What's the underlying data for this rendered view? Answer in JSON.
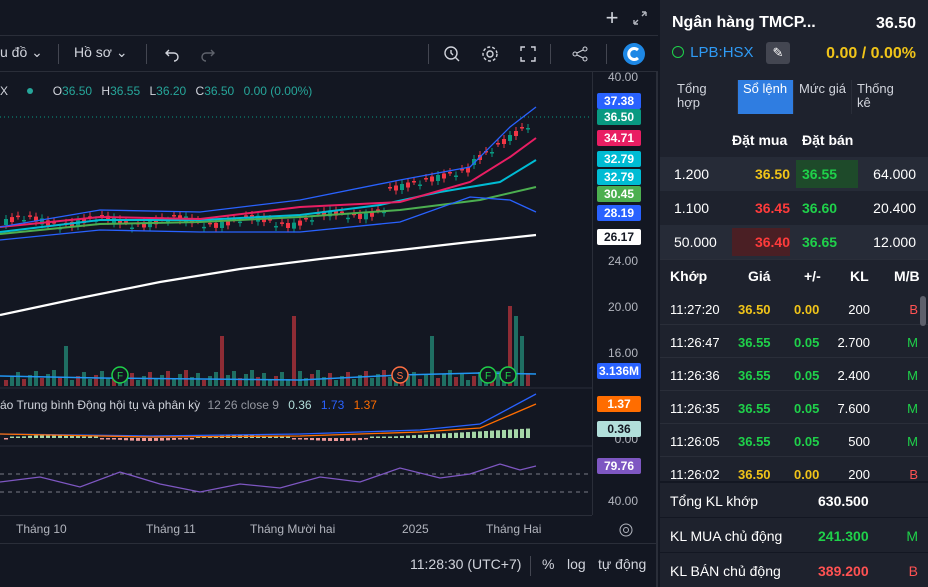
{
  "panel": {
    "company_name": "Ngân hàng TMCP...",
    "price": "36.50",
    "ticker": "LPB:HSX",
    "change": "0.00 / 0.00%",
    "tabs": [
      {
        "label": "Tổng hợp"
      },
      {
        "label": "Sổ lệnh"
      },
      {
        "label": "Mức giá"
      },
      {
        "label": "Thống kê"
      }
    ],
    "orderbook_headers": {
      "buy": "Đặt mua",
      "sell": "Đặt bán"
    },
    "orderbook": [
      {
        "buy_vol": "1.200",
        "buy_price": "36.50",
        "sell_price": "36.55",
        "sell_vol": "64.000"
      },
      {
        "buy_vol": "1.100",
        "buy_price": "36.45",
        "sell_price": "36.60",
        "sell_vol": "20.400"
      },
      {
        "buy_vol": "50.000",
        "buy_price": "36.40",
        "sell_price": "36.65",
        "sell_vol": "12.000"
      }
    ],
    "trade_headers": {
      "time": "Khớp",
      "price": "Giá",
      "change": "+/-",
      "vol": "KL",
      "side": "M/B"
    },
    "trades": [
      {
        "time": "11:27:20",
        "price": "36.50",
        "change": "0.00",
        "vol": "200",
        "side": "B"
      },
      {
        "time": "11:26:47",
        "price": "36.55",
        "change": "0.05",
        "vol": "2.700",
        "side": "M"
      },
      {
        "time": "11:26:36",
        "price": "36.55",
        "change": "0.05",
        "vol": "2.400",
        "side": "M"
      },
      {
        "time": "11:26:35",
        "price": "36.55",
        "change": "0.05",
        "vol": "7.600",
        "side": "M"
      },
      {
        "time": "11:26:05",
        "price": "36.55",
        "change": "0.05",
        "vol": "500",
        "side": "M"
      },
      {
        "time": "11:26:02",
        "price": "36.50",
        "change": "0.00",
        "vol": "200",
        "side": "B"
      }
    ],
    "summary": [
      {
        "label": "Tổng KL khớp",
        "value": "630.500",
        "side": ""
      },
      {
        "label": "KL MUA chủ động",
        "value": "241.300",
        "side": "M"
      },
      {
        "label": "KL BÁN chủ động",
        "value": "389.200",
        "side": "B"
      }
    ]
  },
  "toolbar": {
    "chart_type_label": "u đồ",
    "profile_label": "Hồ sơ"
  },
  "legend": {
    "symbol_tail": "X",
    "o_label": "O",
    "o_value": "36.50",
    "h_label": "H",
    "h_value": "36.55",
    "l_label": "L",
    "l_value": "36.20",
    "c_label": "C",
    "c_value": "36.50",
    "change": "0.00 (0.00%)"
  },
  "macd_legend": {
    "name": "áo Trung bình Động hội tụ và phân kỳ",
    "params": "12 26 close 9",
    "v1": "0.36",
    "v2": "1.73",
    "v3": "1.37"
  },
  "price_axis": {
    "ticks": [
      "40.00",
      "24.00",
      "20.00",
      "16.00",
      "0.00",
      "40.00"
    ],
    "labels": [
      {
        "text": "37.38",
        "color": "#2962ff"
      },
      {
        "text": "36.50",
        "color": "#089981"
      },
      {
        "text": "34.71",
        "color": "#e91e63"
      },
      {
        "text": "32.79",
        "color": "#00bcd4"
      },
      {
        "text": "32.79",
        "color": "#00bcd4"
      },
      {
        "text": "30.45",
        "color": "#4caf50"
      },
      {
        "text": "28.19",
        "color": "#2962ff"
      },
      {
        "text": "26.17",
        "color": "#ffffff"
      },
      {
        "text": "3.136M",
        "color": "#2962ff"
      },
      {
        "text": "1.37",
        "color": "#ff6d00"
      },
      {
        "text": "0.36",
        "color": "#b2dfdb"
      },
      {
        "text": "79.76",
        "color": "#7e57c2"
      }
    ]
  },
  "time_axis": {
    "labels": [
      "Tháng 10",
      "Tháng 11",
      "Tháng Mười hai",
      "2025",
      "Tháng Hai"
    ]
  },
  "bottombar": {
    "time": "11:28:30 (UTC+7)",
    "percent": "%",
    "log": "log",
    "auto": "tự động"
  },
  "markers": [
    {
      "letter": "F",
      "color": "#1fd14a"
    },
    {
      "letter": "S",
      "color": "#ff7043"
    },
    {
      "letter": "F",
      "color": "#1fd14a"
    },
    {
      "letter": "F",
      "color": "#1fd14a"
    }
  ],
  "colors": {
    "up": "#089981",
    "down": "#f23645",
    "accent": "#2f7de1"
  }
}
